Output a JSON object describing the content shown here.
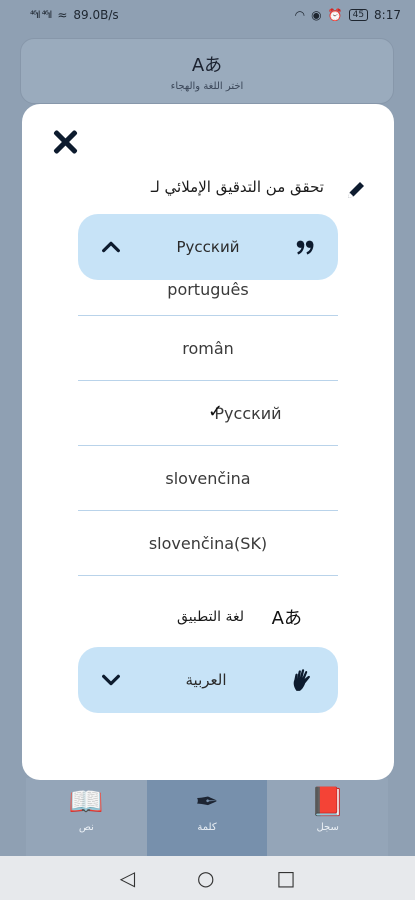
{
  "status_bar": {
    "signal_left": "⁴⁶ıl ⁴⁶ıl",
    "speed": "89.0B/s",
    "battery": "45",
    "time": "8:17"
  },
  "background": {
    "top_card_glyph": "Aあ",
    "top_card_label": "اختر اللغة والهجاء",
    "tabs": [
      {
        "label": "نص"
      },
      {
        "label": "كلمة"
      },
      {
        "label": "سجل"
      }
    ]
  },
  "dialog": {
    "spellcheck_title": "تحقق من التدقيق الإملائي لـ",
    "spell_language_selected": "Русский",
    "languages": [
      {
        "label": "português",
        "partial": true,
        "selected": false
      },
      {
        "label": "român",
        "partial": false,
        "selected": false
      },
      {
        "label": "Русский",
        "partial": false,
        "selected": true
      },
      {
        "label": "slovenčina",
        "partial": false,
        "selected": false
      },
      {
        "label": "slovenčina(SK)",
        "partial": false,
        "selected": false
      }
    ],
    "check_mark": "✓",
    "app_language_title": "لغة التطبيق",
    "app_language_icon": "Aあ",
    "app_language_selected": "العربية"
  },
  "colors": {
    "overlay": "#8fa0b3",
    "select_bg": "#c7e3f7",
    "divider": "#b9d3ea"
  }
}
